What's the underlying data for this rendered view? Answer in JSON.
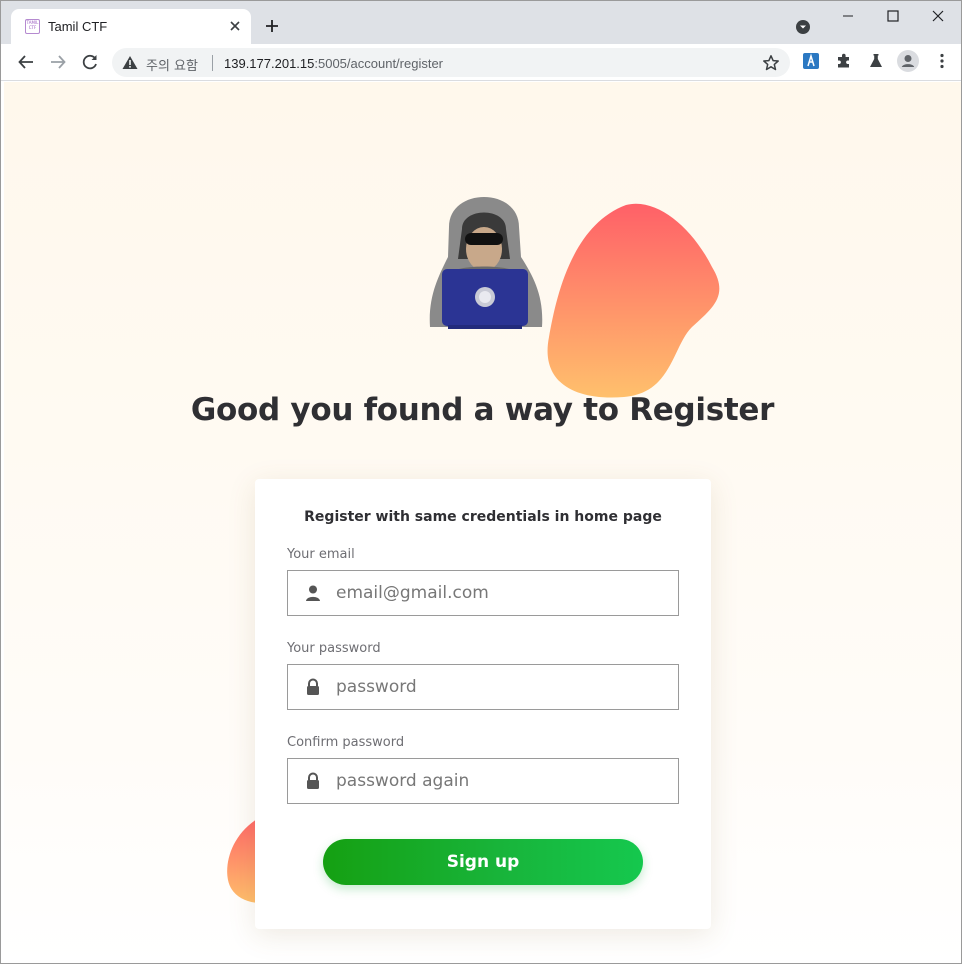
{
  "browser": {
    "tab_title": "Tamil CTF",
    "favicon_text": "TAMIL CTF",
    "security_label": "주의 요함",
    "url_host": "139.177.201.15",
    "url_path": ":5005/account/register",
    "icons": [
      "back-icon",
      "forward-icon",
      "reload-icon",
      "warning-icon",
      "star-icon",
      "puzzle-icon",
      "flask-icon",
      "profile-icon",
      "more-icon"
    ]
  },
  "page": {
    "title": "Good you found a way to Register",
    "colors": {
      "blob_top": "#ff6068",
      "blob_bottom": "#ffc06c",
      "button_start": "#15a012",
      "button_end": "#15c84e",
      "laptop": "#2b3494"
    }
  },
  "form": {
    "heading": "Register with same credentials in home page",
    "email_label": "Your email",
    "email_placeholder": "email@gmail.com",
    "password_label": "Your password",
    "password_placeholder": "password",
    "confirm_label": "Confirm password",
    "confirm_placeholder": "password again",
    "submit_label": "Sign up"
  }
}
